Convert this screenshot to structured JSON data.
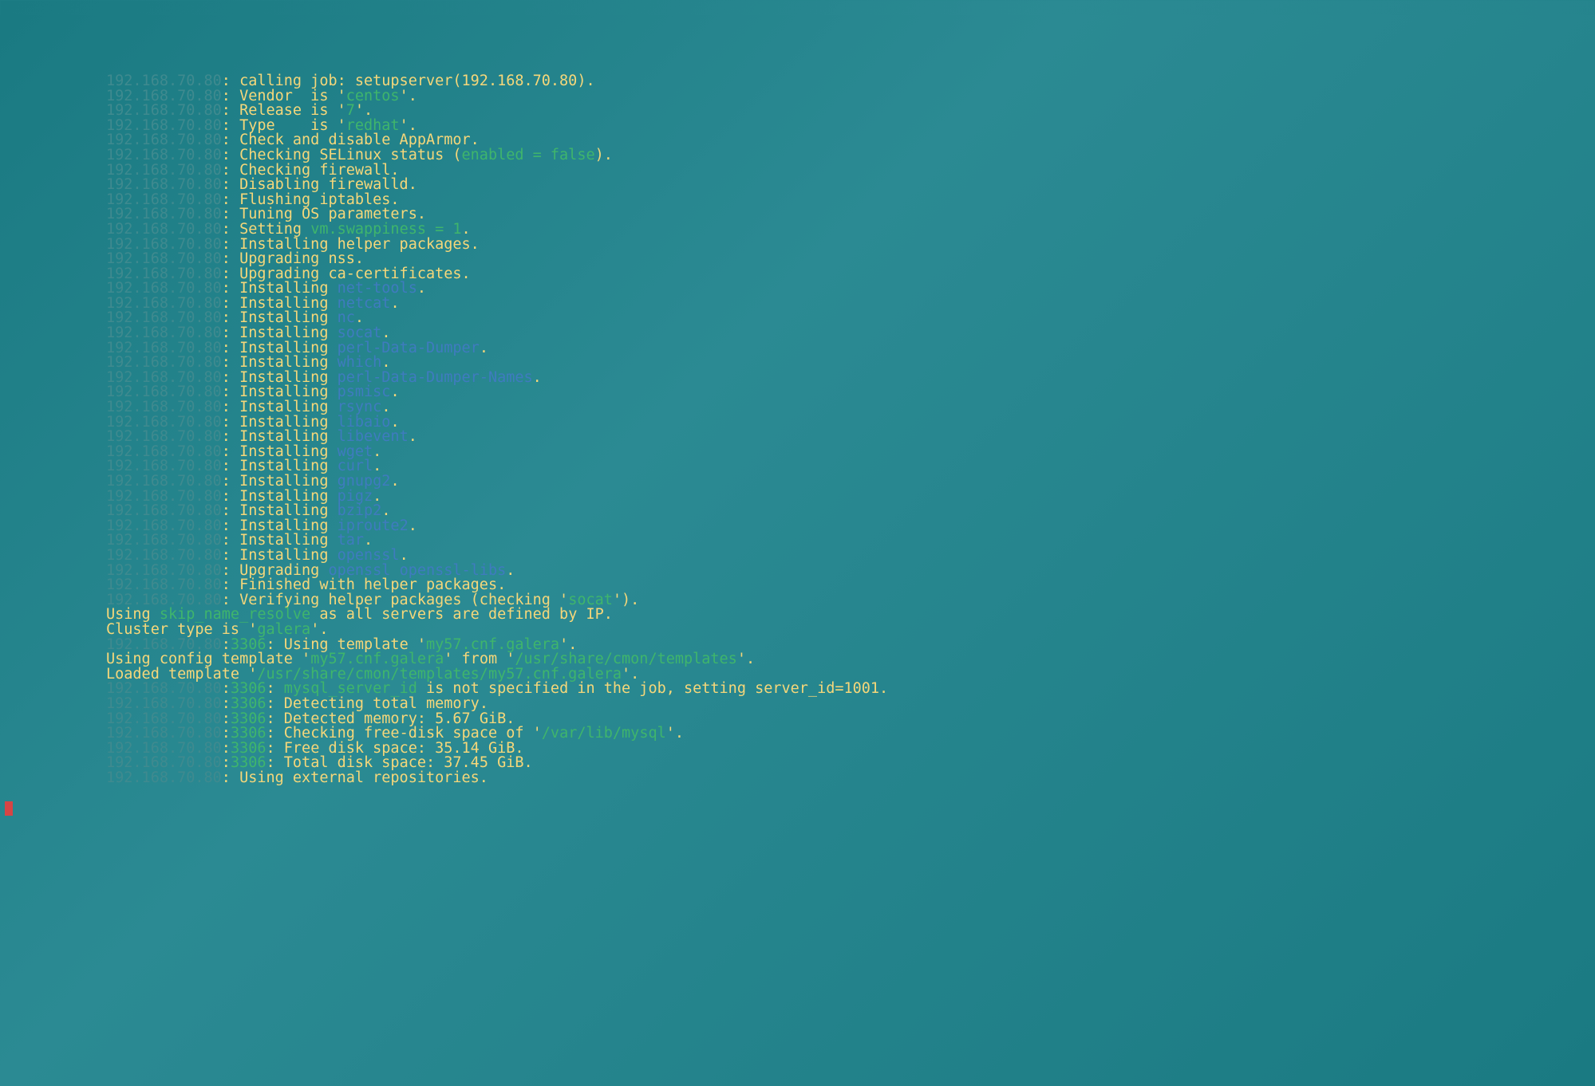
{
  "ip": "192.168.70.80",
  "port": "3306",
  "lines": [
    {
      "type": "ip",
      "text": "calling job: setupserver(192.168.70.80)."
    },
    {
      "type": "ip",
      "segs": [
        [
          "yellow",
          "Vendor  is '"
        ],
        [
          "green",
          "centos"
        ],
        [
          "yellow",
          "'."
        ]
      ]
    },
    {
      "type": "ip",
      "segs": [
        [
          "yellow",
          "Release is '"
        ],
        [
          "green",
          "7"
        ],
        [
          "yellow",
          "'."
        ]
      ]
    },
    {
      "type": "ip",
      "segs": [
        [
          "yellow",
          "Type    is '"
        ],
        [
          "green",
          "redhat"
        ],
        [
          "yellow",
          "'."
        ]
      ]
    },
    {
      "type": "ip",
      "text": "Check and disable AppArmor."
    },
    {
      "type": "ip",
      "segs": [
        [
          "yellow",
          "Checking SELinux status ("
        ],
        [
          "green",
          "enabled = false"
        ],
        [
          "yellow",
          ")."
        ]
      ]
    },
    {
      "type": "ip",
      "text": "Checking firewall."
    },
    {
      "type": "ip",
      "text": "Disabling firewalld."
    },
    {
      "type": "ip",
      "text": "Flushing iptables."
    },
    {
      "type": "ip",
      "text": "Tuning OS parameters."
    },
    {
      "type": "ip",
      "segs": [
        [
          "yellow",
          "Setting "
        ],
        [
          "green",
          "vm.swappiness = 1"
        ],
        [
          "yellow",
          "."
        ]
      ]
    },
    {
      "type": "ip",
      "text": "Installing helper packages."
    },
    {
      "type": "ip",
      "text": "Upgrading nss."
    },
    {
      "type": "ip",
      "text": "Upgrading ca-certificates."
    },
    {
      "type": "ip",
      "segs": [
        [
          "yellow",
          "Installing "
        ],
        [
          "pkg",
          "net-tools"
        ],
        [
          "yellow",
          "."
        ]
      ]
    },
    {
      "type": "ip",
      "segs": [
        [
          "yellow",
          "Installing "
        ],
        [
          "pkg",
          "netcat"
        ],
        [
          "yellow",
          "."
        ]
      ]
    },
    {
      "type": "ip",
      "segs": [
        [
          "yellow",
          "Installing "
        ],
        [
          "pkg",
          "nc"
        ],
        [
          "yellow",
          "."
        ]
      ]
    },
    {
      "type": "ip",
      "segs": [
        [
          "yellow",
          "Installing "
        ],
        [
          "pkg",
          "socat"
        ],
        [
          "yellow",
          "."
        ]
      ]
    },
    {
      "type": "ip",
      "segs": [
        [
          "yellow",
          "Installing "
        ],
        [
          "pkg",
          "perl-Data-Dumper"
        ],
        [
          "yellow",
          "."
        ]
      ]
    },
    {
      "type": "ip",
      "segs": [
        [
          "yellow",
          "Installing "
        ],
        [
          "pkg",
          "which"
        ],
        [
          "yellow",
          "."
        ]
      ]
    },
    {
      "type": "ip",
      "segs": [
        [
          "yellow",
          "Installing "
        ],
        [
          "pkg",
          "perl-Data-Dumper-Names"
        ],
        [
          "yellow",
          "."
        ]
      ]
    },
    {
      "type": "ip",
      "segs": [
        [
          "yellow",
          "Installing "
        ],
        [
          "pkg",
          "psmisc"
        ],
        [
          "yellow",
          "."
        ]
      ]
    },
    {
      "type": "ip",
      "segs": [
        [
          "yellow",
          "Installing "
        ],
        [
          "pkg",
          "rsync"
        ],
        [
          "yellow",
          "."
        ]
      ]
    },
    {
      "type": "ip",
      "segs": [
        [
          "yellow",
          "Installing "
        ],
        [
          "pkg",
          "libaio"
        ],
        [
          "yellow",
          "."
        ]
      ]
    },
    {
      "type": "ip",
      "segs": [
        [
          "yellow",
          "Installing "
        ],
        [
          "pkg",
          "libevent"
        ],
        [
          "yellow",
          "."
        ]
      ]
    },
    {
      "type": "ip",
      "segs": [
        [
          "yellow",
          "Installing "
        ],
        [
          "pkg",
          "wget"
        ],
        [
          "yellow",
          "."
        ]
      ]
    },
    {
      "type": "ip",
      "segs": [
        [
          "yellow",
          "Installing "
        ],
        [
          "pkg",
          "curl"
        ],
        [
          "yellow",
          "."
        ]
      ]
    },
    {
      "type": "ip",
      "segs": [
        [
          "yellow",
          "Installing "
        ],
        [
          "pkg",
          "gnupg2"
        ],
        [
          "yellow",
          "."
        ]
      ]
    },
    {
      "type": "ip",
      "segs": [
        [
          "yellow",
          "Installing "
        ],
        [
          "pkg",
          "pigz"
        ],
        [
          "yellow",
          "."
        ]
      ]
    },
    {
      "type": "ip",
      "segs": [
        [
          "yellow",
          "Installing "
        ],
        [
          "pkg",
          "bzip2"
        ],
        [
          "yellow",
          "."
        ]
      ]
    },
    {
      "type": "ip",
      "segs": [
        [
          "yellow",
          "Installing "
        ],
        [
          "pkg",
          "iproute2"
        ],
        [
          "yellow",
          "."
        ]
      ]
    },
    {
      "type": "ip",
      "segs": [
        [
          "yellow",
          "Installing "
        ],
        [
          "pkg",
          "tar"
        ],
        [
          "yellow",
          "."
        ]
      ]
    },
    {
      "type": "ip",
      "segs": [
        [
          "yellow",
          "Installing "
        ],
        [
          "pkg",
          "openssl"
        ],
        [
          "yellow",
          "."
        ]
      ]
    },
    {
      "type": "ip",
      "segs": [
        [
          "yellow",
          "Upgrading "
        ],
        [
          "pkg",
          "openssl openssl-libs"
        ],
        [
          "yellow",
          "."
        ]
      ]
    },
    {
      "type": "ip",
      "text": "Finished with helper packages."
    },
    {
      "type": "ip",
      "segs": [
        [
          "yellow",
          "Verifying helper packages (checking '"
        ],
        [
          "green",
          "socat"
        ],
        [
          "yellow",
          "')."
        ]
      ]
    },
    {
      "type": "plain",
      "segs": [
        [
          "yellow",
          "Using "
        ],
        [
          "green",
          "skip_name_resolve"
        ],
        [
          "yellow",
          " as all servers are defined by IP."
        ]
      ]
    },
    {
      "type": "plain",
      "segs": [
        [
          "yellow",
          "Cluster type is '"
        ],
        [
          "green",
          "galera"
        ],
        [
          "yellow",
          "'."
        ]
      ]
    },
    {
      "type": "ipport",
      "segs": [
        [
          "yellow",
          "Using template '"
        ],
        [
          "green",
          "my57.cnf.galera"
        ],
        [
          "yellow",
          "'."
        ]
      ]
    },
    {
      "type": "plain",
      "segs": [
        [
          "yellow",
          "Using config template '"
        ],
        [
          "green",
          "my57.cnf.galera"
        ],
        [
          "yellow",
          "' from '"
        ],
        [
          "green",
          "/usr/share/cmon/templates"
        ],
        [
          "yellow",
          "'."
        ]
      ]
    },
    {
      "type": "plain",
      "segs": [
        [
          "yellow",
          "Loaded template '"
        ],
        [
          "green",
          "/usr/share/cmon/templates/my57.cnf.galera"
        ],
        [
          "yellow",
          "'."
        ]
      ]
    },
    {
      "type": "ipport",
      "segs": [
        [
          "green",
          "mysql_server_id"
        ],
        [
          "yellow",
          " is not specified in the job, setting server_id=1001."
        ]
      ]
    },
    {
      "type": "ipport",
      "text": "Detecting total memory."
    },
    {
      "type": "ipport",
      "text": "Detected memory: 5.67 GiB."
    },
    {
      "type": "ipport",
      "segs": [
        [
          "yellow",
          "Checking free-disk space of '"
        ],
        [
          "green",
          "/var/lib/mysql"
        ],
        [
          "yellow",
          "'."
        ]
      ]
    },
    {
      "type": "ipport",
      "text": "Free disk space: 35.14 GiB."
    },
    {
      "type": "ipport",
      "text": "Total disk space: 37.45 GiB."
    },
    {
      "type": "ip",
      "text": "Using external repositories."
    }
  ]
}
